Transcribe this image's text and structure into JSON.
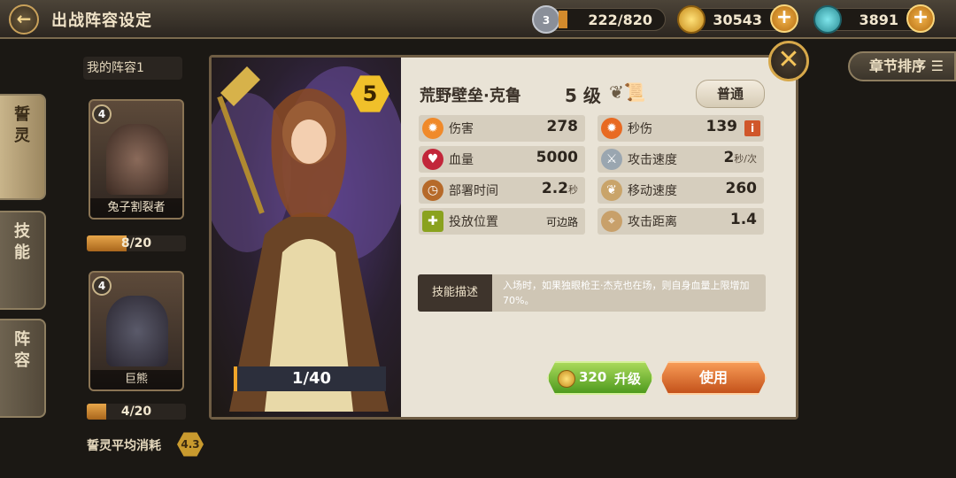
{
  "header": {
    "back_glyph": "←",
    "title": "出战阵容设定",
    "resources": [
      {
        "name": "shield-resource",
        "value": "222/820",
        "badge": "3",
        "color": "#8a8f99"
      },
      {
        "name": "gold-coin",
        "value": "30543",
        "color": "#e2b23c"
      },
      {
        "name": "gem",
        "value": "3891",
        "color": "#3fb0b8"
      }
    ],
    "plus_glyph": "+"
  },
  "side_tabs": [
    {
      "label": "誓\n灵",
      "active": true
    },
    {
      "label": "技\n能",
      "active": false
    },
    {
      "label": "阵\n容",
      "active": false
    }
  ],
  "lineup": {
    "title": "我的阵容1",
    "cards": [
      {
        "level": "4",
        "name": "兔子割裂者",
        "progress_text": "8/20",
        "progress": 0.4
      },
      {
        "level": "4",
        "name": "巨熊",
        "progress_text": "4/20",
        "progress": 0.2
      }
    ],
    "avg_cost_label": "誓灵平均消耗",
    "avg_cost_value": "4.3"
  },
  "sort_button": "章节排序",
  "dialog": {
    "close_glyph": "✕",
    "star": "5",
    "count_text": "1/40",
    "count_progress": 0.025,
    "hero_name": "荒野壁垒·克鲁",
    "level_text": "5 级",
    "rarity": "普通",
    "stats": [
      {
        "icon": "damage-icon",
        "glyph": "✹",
        "name": "伤害",
        "value": "278",
        "unit": ""
      },
      {
        "icon": "dps-icon",
        "glyph": "✹",
        "name": "秒伤",
        "value": "139",
        "unit": "",
        "info": "i"
      },
      {
        "icon": "health-icon",
        "glyph": "♥",
        "name": "血量",
        "value": "5000",
        "unit": ""
      },
      {
        "icon": "attack-speed-icon",
        "glyph": "⚔",
        "name": "攻击速度",
        "value": "2",
        "unit": "秒/次"
      },
      {
        "icon": "deploy-time-icon",
        "glyph": "◷",
        "name": "部署时间",
        "value": "2.2",
        "unit": "秒"
      },
      {
        "icon": "move-speed-icon",
        "glyph": "❦",
        "name": "移动速度",
        "value": "260",
        "unit": ""
      },
      {
        "icon": "deploy-position-icon",
        "glyph": "✚",
        "name": "投放位置",
        "value": "可边路",
        "unit": ""
      },
      {
        "icon": "attack-range-icon",
        "glyph": "⌖",
        "name": "攻击距离",
        "value": "1.4",
        "unit": ""
      }
    ],
    "skill_label": "技能描述",
    "skill_text": "入场时，如果独眼枪王·杰克也在场，则自身血量上限增加70%。",
    "upgrade_cost": "320",
    "upgrade_label": "升级",
    "use_label": "使用"
  }
}
